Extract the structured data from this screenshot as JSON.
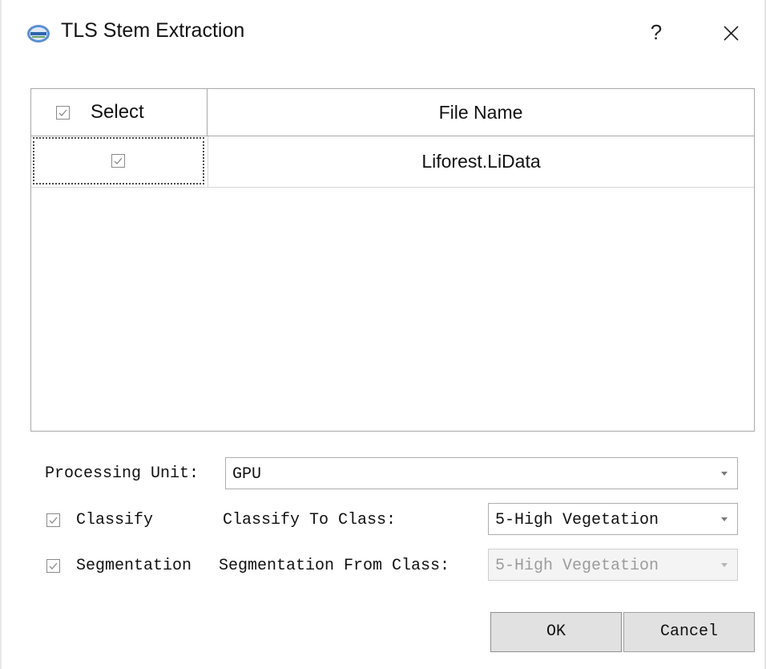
{
  "window": {
    "title": "TLS Stem Extraction",
    "help_label": "?",
    "icon": "app-logo-icon"
  },
  "table": {
    "columns": [
      "Select",
      "File Name"
    ],
    "header_select_checked": true,
    "rows": [
      {
        "selected": true,
        "file_name": "Liforest.LiData"
      }
    ]
  },
  "options": {
    "processing_unit_label": "Processing Unit:",
    "processing_unit_value": "GPU",
    "classify_label": "Classify",
    "classify_checked": true,
    "classify_to_label": "Classify To Class:",
    "classify_to_value": "5-High Vegetation",
    "segmentation_label": "Segmentation",
    "segmentation_checked": true,
    "segmentation_from_label": "Segmentation From Class:",
    "segmentation_from_value": "5-High Vegetation",
    "segmentation_from_disabled": true
  },
  "buttons": {
    "ok": "OK",
    "cancel": "Cancel"
  }
}
